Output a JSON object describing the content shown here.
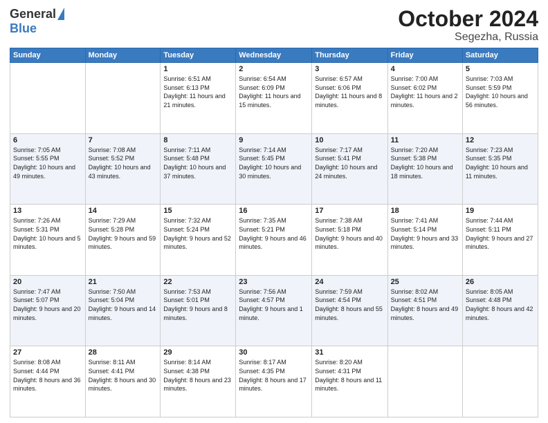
{
  "header": {
    "logo_general": "General",
    "logo_blue": "Blue",
    "month": "October 2024",
    "location": "Segezha, Russia"
  },
  "days_of_week": [
    "Sunday",
    "Monday",
    "Tuesday",
    "Wednesday",
    "Thursday",
    "Friday",
    "Saturday"
  ],
  "weeks": [
    [
      {
        "day": "",
        "content": ""
      },
      {
        "day": "",
        "content": ""
      },
      {
        "day": "1",
        "content": "Sunrise: 6:51 AM\nSunset: 6:13 PM\nDaylight: 11 hours and 21 minutes."
      },
      {
        "day": "2",
        "content": "Sunrise: 6:54 AM\nSunset: 6:09 PM\nDaylight: 11 hours and 15 minutes."
      },
      {
        "day": "3",
        "content": "Sunrise: 6:57 AM\nSunset: 6:06 PM\nDaylight: 11 hours and 8 minutes."
      },
      {
        "day": "4",
        "content": "Sunrise: 7:00 AM\nSunset: 6:02 PM\nDaylight: 11 hours and 2 minutes."
      },
      {
        "day": "5",
        "content": "Sunrise: 7:03 AM\nSunset: 5:59 PM\nDaylight: 10 hours and 56 minutes."
      }
    ],
    [
      {
        "day": "6",
        "content": "Sunrise: 7:05 AM\nSunset: 5:55 PM\nDaylight: 10 hours and 49 minutes."
      },
      {
        "day": "7",
        "content": "Sunrise: 7:08 AM\nSunset: 5:52 PM\nDaylight: 10 hours and 43 minutes."
      },
      {
        "day": "8",
        "content": "Sunrise: 7:11 AM\nSunset: 5:48 PM\nDaylight: 10 hours and 37 minutes."
      },
      {
        "day": "9",
        "content": "Sunrise: 7:14 AM\nSunset: 5:45 PM\nDaylight: 10 hours and 30 minutes."
      },
      {
        "day": "10",
        "content": "Sunrise: 7:17 AM\nSunset: 5:41 PM\nDaylight: 10 hours and 24 minutes."
      },
      {
        "day": "11",
        "content": "Sunrise: 7:20 AM\nSunset: 5:38 PM\nDaylight: 10 hours and 18 minutes."
      },
      {
        "day": "12",
        "content": "Sunrise: 7:23 AM\nSunset: 5:35 PM\nDaylight: 10 hours and 11 minutes."
      }
    ],
    [
      {
        "day": "13",
        "content": "Sunrise: 7:26 AM\nSunset: 5:31 PM\nDaylight: 10 hours and 5 minutes."
      },
      {
        "day": "14",
        "content": "Sunrise: 7:29 AM\nSunset: 5:28 PM\nDaylight: 9 hours and 59 minutes."
      },
      {
        "day": "15",
        "content": "Sunrise: 7:32 AM\nSunset: 5:24 PM\nDaylight: 9 hours and 52 minutes."
      },
      {
        "day": "16",
        "content": "Sunrise: 7:35 AM\nSunset: 5:21 PM\nDaylight: 9 hours and 46 minutes."
      },
      {
        "day": "17",
        "content": "Sunrise: 7:38 AM\nSunset: 5:18 PM\nDaylight: 9 hours and 40 minutes."
      },
      {
        "day": "18",
        "content": "Sunrise: 7:41 AM\nSunset: 5:14 PM\nDaylight: 9 hours and 33 minutes."
      },
      {
        "day": "19",
        "content": "Sunrise: 7:44 AM\nSunset: 5:11 PM\nDaylight: 9 hours and 27 minutes."
      }
    ],
    [
      {
        "day": "20",
        "content": "Sunrise: 7:47 AM\nSunset: 5:07 PM\nDaylight: 9 hours and 20 minutes."
      },
      {
        "day": "21",
        "content": "Sunrise: 7:50 AM\nSunset: 5:04 PM\nDaylight: 9 hours and 14 minutes."
      },
      {
        "day": "22",
        "content": "Sunrise: 7:53 AM\nSunset: 5:01 PM\nDaylight: 9 hours and 8 minutes."
      },
      {
        "day": "23",
        "content": "Sunrise: 7:56 AM\nSunset: 4:57 PM\nDaylight: 9 hours and 1 minute."
      },
      {
        "day": "24",
        "content": "Sunrise: 7:59 AM\nSunset: 4:54 PM\nDaylight: 8 hours and 55 minutes."
      },
      {
        "day": "25",
        "content": "Sunrise: 8:02 AM\nSunset: 4:51 PM\nDaylight: 8 hours and 49 minutes."
      },
      {
        "day": "26",
        "content": "Sunrise: 8:05 AM\nSunset: 4:48 PM\nDaylight: 8 hours and 42 minutes."
      }
    ],
    [
      {
        "day": "27",
        "content": "Sunrise: 8:08 AM\nSunset: 4:44 PM\nDaylight: 8 hours and 36 minutes."
      },
      {
        "day": "28",
        "content": "Sunrise: 8:11 AM\nSunset: 4:41 PM\nDaylight: 8 hours and 30 minutes."
      },
      {
        "day": "29",
        "content": "Sunrise: 8:14 AM\nSunset: 4:38 PM\nDaylight: 8 hours and 23 minutes."
      },
      {
        "day": "30",
        "content": "Sunrise: 8:17 AM\nSunset: 4:35 PM\nDaylight: 8 hours and 17 minutes."
      },
      {
        "day": "31",
        "content": "Sunrise: 8:20 AM\nSunset: 4:31 PM\nDaylight: 8 hours and 11 minutes."
      },
      {
        "day": "",
        "content": ""
      },
      {
        "day": "",
        "content": ""
      }
    ]
  ]
}
